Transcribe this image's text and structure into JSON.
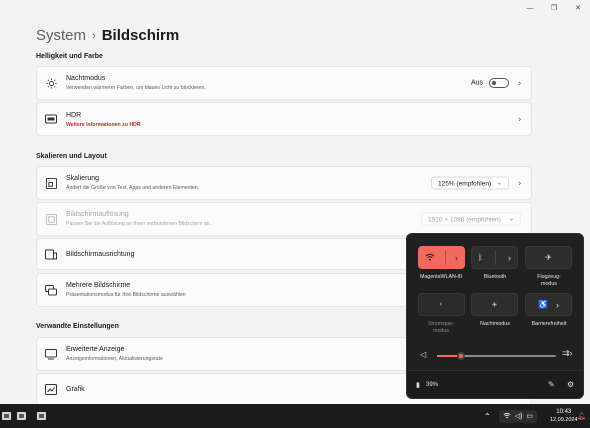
{
  "breadcrumb": {
    "parent": "System",
    "separator": "›",
    "current": "Bildschirm"
  },
  "sections": {
    "brightness": "Helligkeit und Farbe",
    "scale": "Skalieren und Layout",
    "related": "Verwandte Einstellungen"
  },
  "night": {
    "title": "Nachtmodus",
    "sub": "Verwenden wärmerer Farben, um blaues Licht zu blockieren.",
    "state": "Aus"
  },
  "hdr": {
    "title": "HDR",
    "sub": "Weitere Informationen zu HDR"
  },
  "scaling": {
    "title": "Skalierung",
    "sub": "Ändert die Größe von Text, Apps und anderen Elementen.",
    "value": "125% (empfohlen)"
  },
  "resolution": {
    "title": "Bildschirmauflösung",
    "sub": "Passen Sie die Auflösung an Ihren verbundenen Bildschirm an.",
    "value": "1920 × 1080 (empfohlen)"
  },
  "orientation": {
    "title": "Bildschirmausrichtung"
  },
  "multi": {
    "title": "Mehrere Bildschirme",
    "sub": "Präsentationsmodus für Ihre Bildschirme auswählen"
  },
  "advanced": {
    "title": "Erweiterte Anzeige",
    "sub": "Anzeigeinformationen, Aktualisierungsrate"
  },
  "graphics": {
    "title": "Grafik"
  },
  "quick": {
    "wifi": "MagentaWLAN-8I",
    "bluetooth": "Bluetooth",
    "airplane": "Flugzeug-\nmodus",
    "saver": "Stromspar-\nmodus",
    "nightlight": "Nachtmodus",
    "access": "Barrierefreiheit",
    "brightness": 0.2,
    "battery": "39%"
  },
  "taskbar": {
    "time": "10:43",
    "date": "12.09.2024"
  },
  "colors": {
    "accent": "#f06b5e",
    "flyout": "#202020",
    "taskbar": "#1c1c1c",
    "hdr_link": "#c42b1c"
  }
}
